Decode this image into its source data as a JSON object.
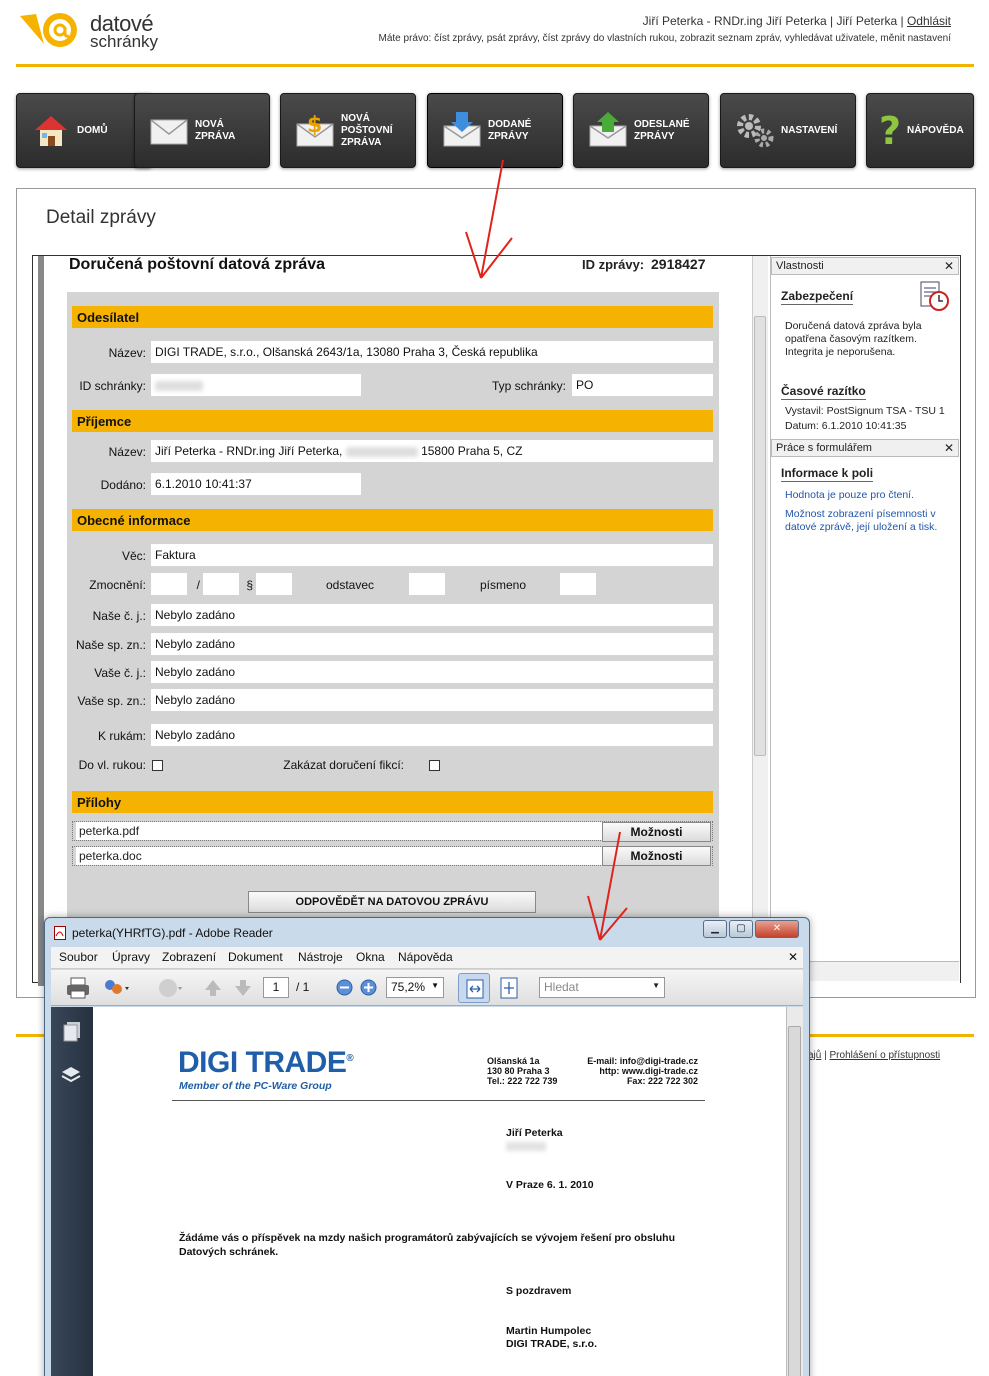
{
  "header": {
    "logo_line1": "datové",
    "logo_line2": "schránky",
    "user_text": "Jiří Peterka - RNDr.ing Jiří Peterka | Jiří Peterka | ",
    "logout": "Odhlásit",
    "rights": "Máte právo: číst zprávy, psát zprávy, číst zprávy do vlastních rukou, zobrazit seznam zpráv, vyhledávat uživatele, měnit nastavení"
  },
  "nav": [
    {
      "label": "DOMŮ",
      "icon": "home-icon"
    },
    {
      "label": "NOVÁ\nZPRÁVA",
      "icon": "envelope-icon"
    },
    {
      "label": "NOVÁ\nPOŠTOVNÍ\nZPRÁVA",
      "icon": "money-envelope-icon"
    },
    {
      "label": "DODANÉ\nZPRÁVY",
      "icon": "inbox-down-icon"
    },
    {
      "label": "ODESLANÉ\nZPRÁVY",
      "icon": "outbox-up-icon"
    },
    {
      "label": "NASTAVENÍ",
      "icon": "gears-icon"
    },
    {
      "label": "NÁPOVĚDA",
      "icon": "help-icon"
    }
  ],
  "detail_title": "Detail zprávy",
  "form": {
    "heading": "Doručená poštovní datová zpráva",
    "msg_id_label": "ID zprávy:",
    "msg_id_value": "2918427",
    "sender_section": "Odesílatel",
    "sender_name_label": "Název:",
    "sender_name": "DIGI TRADE, s.r.o., Olšanská 2643/1a, 13080 Praha 3, Česká republika",
    "box_id_label": "ID schránky:",
    "box_type_label": "Typ schránky:",
    "box_type": "PO",
    "recipient_section": "Příjemce",
    "recipient_name_label": "Název:",
    "recipient_name_a": "Jiří Peterka - RNDr.ing Jiří Peterka,",
    "recipient_name_b": "15800 Praha 5, CZ",
    "delivered_label": "Dodáno:",
    "delivered": "6.1.2010 10:41:37",
    "general_section": "Obecné informace",
    "subject_label": "Věc:",
    "subject": "Faktura",
    "auth_label": "Zmocnění:",
    "auth_slash": "/",
    "auth_par": "§",
    "auth_odst": "odstavec",
    "auth_pism": "písmeno",
    "our_ref_label": "Naše č. j.:",
    "our_ref": "Nebylo zadáno",
    "our_file_label": "Naše sp. zn.:",
    "our_file": "Nebylo zadáno",
    "your_ref_label": "Vaše č. j.:",
    "your_ref": "Nebylo zadáno",
    "your_file_label": "Vaše sp. zn.:",
    "your_file": "Nebylo zadáno",
    "to_hands_label": "K rukám:",
    "to_hands": "Nebylo zadáno",
    "own_hands_label": "Do vl. rukou:",
    "no_fiction_label": "Zakázat doručení fikcí:",
    "attach_section": "Přílohy",
    "attachments": [
      {
        "name": "peterka.pdf",
        "button": "Možnosti"
      },
      {
        "name": "peterka.doc",
        "button": "Možnosti"
      }
    ],
    "reply_button": "ODPOVĚDĚT NA DATOVOU ZPRÁVU"
  },
  "side": {
    "props_header": "Vlastnosti",
    "security_title": "Zabezpečení",
    "security_text": "Doručená datová zpráva byla opatřena  časovým razítkem. Integrita je neporušena.",
    "timestamp_title": "Časové razítko",
    "issuer": "Vystavil: PostSignum TSA - TSU 1",
    "date": "Datum:    6.1.2010 10:41:35",
    "work_header": "Práce s formulářem",
    "field_info_title": "Informace k poli",
    "readonly_text": "Hodnota je pouze pro čtení.",
    "print_text": "Možnost zobrazení písemnosti v datové zprávě, její uložení a tisk."
  },
  "footer": {
    "link": "Prohlášení o přístupnosti",
    "frag": "ajů"
  },
  "adobe": {
    "title": "peterka(YHRfTG).pdf - Adobe Reader",
    "menus": [
      "Soubor",
      "Úpravy",
      "Zobrazení",
      "Dokument",
      "Nástroje",
      "Okna",
      "Nápověda"
    ],
    "page_num": "1",
    "page_total": "/ 1",
    "zoom": "75,2%",
    "search_placeholder": "Hledat"
  },
  "pdf": {
    "logo": "DIGI TRADE",
    "reg": "®",
    "tagline": "Member of the PC-Ware Group",
    "address": "Olšanská 1a\n130 80 Praha 3\nTel.: 222 722 739",
    "contact": "E-mail: info@digi-trade.cz\nhttp: www.digi-trade.cz\nFax: 222 722 302",
    "recipient": "Jiří Peterka",
    "place_date": "V Praze 6. 1. 2010",
    "body": "Žádáme vás o příspěvek na mzdy našich programátorů zabývajících se vývojem řešení pro obsluhu Datových schránek.",
    "greeting": "S pozdravem",
    "signer": "Martin Humpolec",
    "signer_company": "DIGI TRADE, s.r.o."
  },
  "colors": {
    "accent": "#f5b300",
    "nav": "#3a3a3a",
    "link": "#2255aa",
    "pdf_brand": "#1f5ea8"
  }
}
